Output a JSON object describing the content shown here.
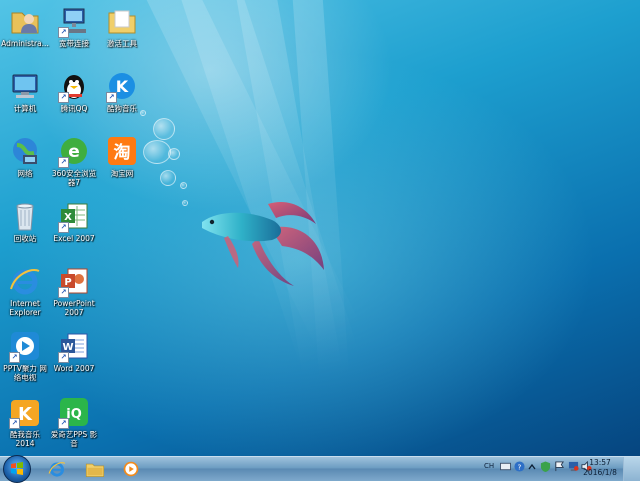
{
  "desktop": {
    "icons": [
      {
        "label": "Administra..."
      },
      {
        "label": "宽带连接"
      },
      {
        "label": "激活工具"
      },
      {
        "label": "计算机"
      },
      {
        "label": "腾讯QQ"
      },
      {
        "label": "酷狗音乐"
      },
      {
        "label": "网络"
      },
      {
        "label": "360安全浏览器7"
      },
      {
        "label": "淘宝网"
      },
      {
        "label": "回收站"
      },
      {
        "label": "Excel 2007"
      },
      {
        "label": "Internet Explorer"
      },
      {
        "label": "PowerPoint 2007"
      },
      {
        "label": "PPTV聚力 网络电视"
      },
      {
        "label": "Word 2007"
      },
      {
        "label": "酷我音乐 2014"
      },
      {
        "label": "爱奇艺PPS 影音"
      }
    ]
  },
  "taskbar": {
    "tray_lang": "CH",
    "clock_time": "13:57",
    "clock_date": "2016/1/8"
  }
}
